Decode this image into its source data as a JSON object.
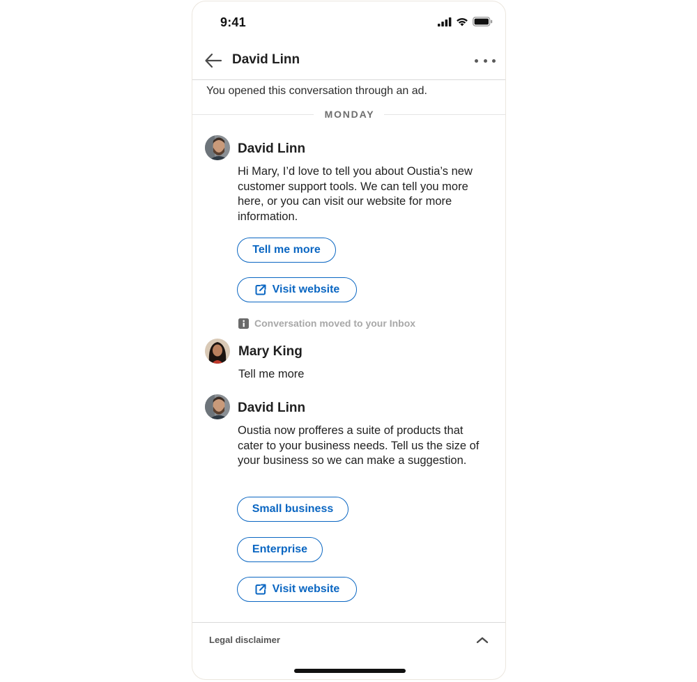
{
  "status_bar": {
    "time": "9:41"
  },
  "header": {
    "title": "David Linn"
  },
  "conversation": {
    "ad_note": "You opened this conversation through an ad.",
    "day_label": "MONDAY",
    "messages": [
      {
        "sender": "David Linn",
        "text": "Hi Mary, I’d love to tell you about Oustia’s new customer support tools. We can tell you more here, or you can visit our website for more information.",
        "actions": [
          "Tell me more",
          "Visit website"
        ]
      },
      {
        "sender": "Mary King",
        "text": "Tell me more"
      },
      {
        "sender": "David Linn",
        "text": "Oustia now profferes a suite of products that cater to your business needs. Tell us the size of your business so we can make a suggestion.",
        "actions": [
          "Small business",
          "Enterprise",
          "Visit website"
        ]
      }
    ],
    "system_note": "Conversation moved to your Inbox"
  },
  "footer": {
    "legal_label": "Legal disclaimer"
  },
  "colors": {
    "accent": "#0a66c2",
    "text": "#1f1f1f",
    "muted": "#a8a8a8"
  },
  "icons": [
    "back-arrow-icon",
    "more-icon",
    "external-link-icon",
    "info-icon",
    "chevron-up-icon",
    "signal-icon",
    "wifi-icon",
    "battery-icon"
  ]
}
